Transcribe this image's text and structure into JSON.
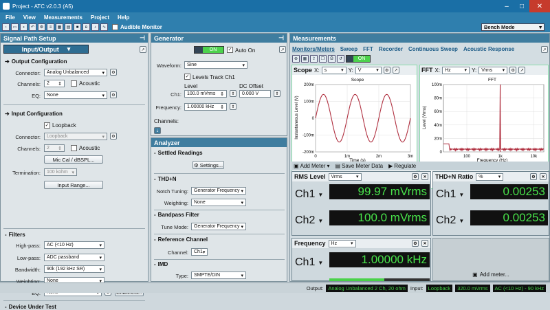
{
  "window": {
    "title": "Project - ATC v2.0.3 (A5)",
    "controls": [
      "–",
      "□",
      "✕"
    ]
  },
  "menu": [
    "File",
    "View",
    "Measurements",
    "Project",
    "Help"
  ],
  "toolbar": {
    "audible_monitor": "Audible Monitor",
    "bench_mode": "Bench Mode"
  },
  "signal_path": {
    "title": "Signal Path Setup",
    "mode": "Input/Output",
    "output": {
      "title": "Output Configuration",
      "connector_label": "Connector:",
      "connector": "Analog Unbalanced",
      "channels_label": "Channels:",
      "channels": "2",
      "acoustic": "Acoustic",
      "eq_label": "EQ:",
      "eq": "None"
    },
    "input": {
      "title": "Input Configuration",
      "loopback": "Loopback",
      "connector_label": "Connector:",
      "connector": "Loopback",
      "channels_label": "Channels:",
      "channels": "2",
      "acoustic": "Acoustic",
      "mic_cal": "Mic Cal / dBSPL...",
      "termination_label": "Termination:",
      "termination": "100 kohm",
      "input_range": "Input Range..."
    },
    "filters": {
      "title": "Filters",
      "highpass_label": "High-pass:",
      "highpass": "AC (<10 Hz)",
      "lowpass_label": "Low-pass:",
      "lowpass": "ADC passband",
      "bandwidth_label": "Bandwidth:",
      "bandwidth": "90k (192 kHz SR)",
      "weighting_label": "Weighting:",
      "weighting": "None",
      "eq_label": "EQ:",
      "eq": "None",
      "channels_btn": "Channels..."
    },
    "dut": "Device Under Test"
  },
  "generator": {
    "title": "Generator",
    "on": "ON",
    "auto_on": "Auto On",
    "waveform_label": "Waveform:",
    "waveform": "Sine",
    "levels_track": "Levels Track Ch1",
    "level_hdr": "Level",
    "dc_hdr": "DC Offset",
    "ch1_label": "Ch1:",
    "level": "100.0 mVrms",
    "dc": "0.000 V",
    "freq_label": "Frequency:",
    "freq": "1.00000 kHz",
    "channels_label": "Channels:"
  },
  "analyzer": {
    "title": "Analyzer",
    "settled": "Settled Readings",
    "settings_btn": "Settings...",
    "thdn": "THD+N",
    "notch_label": "Notch Tuning:",
    "notch": "Generator Frequency",
    "weight_label": "Weighting:",
    "weight": "None",
    "bandpass": "Bandpass Filter",
    "tune_label": "Tune Mode:",
    "tune": "Generator Frequency",
    "ref": "Reference Channel",
    "ref_ch_label": "Channel:",
    "ref_ch": "Ch1",
    "imd": "IMD",
    "type_label": "Type:",
    "type": "SMPTE/DIN"
  },
  "measurements": {
    "title": "Measurements",
    "tabs": [
      "Monitors/Meters",
      "Sweep",
      "FFT",
      "Recorder",
      "Continuous Sweep",
      "Acoustic Response"
    ],
    "on": "ON"
  },
  "scope": {
    "label": "Scope",
    "x_label": "X:",
    "x_unit": "s",
    "y_label": "Y:",
    "y_unit": "V",
    "plot_title": "Scope",
    "ylabel": "Instantaneous Level (V)",
    "xlabel": "Time (s)",
    "yticks": [
      "200m",
      "100m",
      "0",
      "-100m",
      "-200m"
    ],
    "xticks": [
      "0",
      "1m",
      "2m",
      "3m"
    ]
  },
  "fft": {
    "label": "FFT",
    "x_label": "X:",
    "x_unit": "Hz",
    "y_label": "Y:",
    "y_unit": "Vrms",
    "plot_title": "FFT",
    "ylabel": "Level (Vrms)",
    "xlabel": "Frequency (Hz)",
    "yticks": [
      "100m",
      "80m",
      "60m",
      "40m",
      "20m",
      "0"
    ],
    "xticks": [
      "100",
      "1k",
      "10k"
    ]
  },
  "meters_toolbar": {
    "add_meter": "Add Meter",
    "save": "Save Meter Data",
    "regulate": "Regulate"
  },
  "meters": {
    "rms": {
      "label": "RMS Level",
      "unit": "Vrms",
      "ch1": "Ch1",
      "ch2": "Ch2",
      "val1": "99.97 mVrms",
      "val2": "100.0 mVrms",
      "bar1": 0.55,
      "bar2": 0.55
    },
    "thdn": {
      "label": "THD+N Ratio",
      "unit": "%",
      "ch1": "Ch1",
      "ch2": "Ch2",
      "val1": "0.00253",
      "val2": "0.00253",
      "bar1": 0.2,
      "bar2": 0.2
    },
    "freq": {
      "label": "Frequency",
      "unit": "Hz",
      "ch1": "Ch1",
      "val1": "1.00000 kHz",
      "bar1": 0.55
    },
    "add": "Add meter..."
  },
  "status": {
    "output_label": "Output:",
    "output": "Analog Unbalanced 2 Ch, 20 ohm",
    "input_label": "Input:",
    "input": "Loopback",
    "level": "320.0 mVrms",
    "filter": "AC (<10 Hz) - 90 kHz"
  },
  "colors": {
    "title": "#1a6fa6",
    "panel_hdr": "#3f7d9f",
    "meter_green": "#48e24a",
    "scope_trace": "#b03040"
  }
}
